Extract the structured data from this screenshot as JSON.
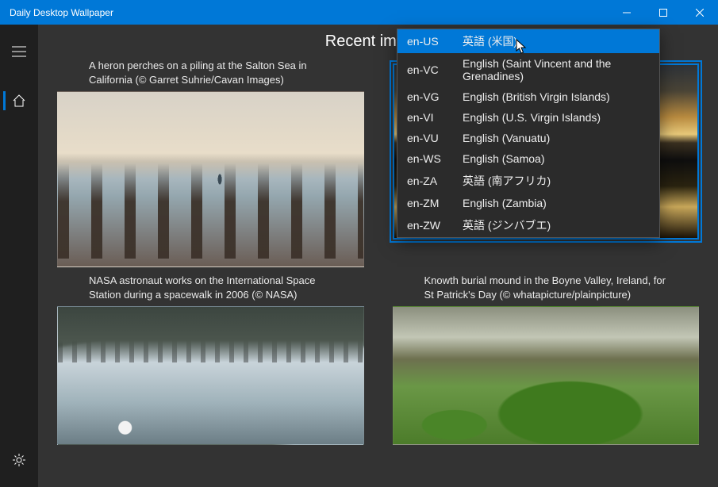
{
  "window": {
    "title": "Daily Desktop Wallpaper"
  },
  "heading": "Recent images",
  "cards": [
    {
      "caption": "A heron perches on a piling at the Salton Sea in California (© Garret Suhrie/Cavan Images)"
    },
    {
      "caption": ""
    },
    {
      "caption": "NASA astronaut works on the International Space Station during a spacewalk in 2006 (© NASA)"
    },
    {
      "caption": "Knowth burial mound in the Boyne Valley, Ireland, for St Patrick's Day (© whatapicture/plainpicture)"
    }
  ],
  "dropdown": {
    "items": [
      {
        "code": "en-US",
        "label": "英語 (米国)"
      },
      {
        "code": "en-VC",
        "label": "English (Saint Vincent and the Grenadines)"
      },
      {
        "code": "en-VG",
        "label": "English (British Virgin Islands)"
      },
      {
        "code": "en-VI",
        "label": "English (U.S. Virgin Islands)"
      },
      {
        "code": "en-VU",
        "label": "English (Vanuatu)"
      },
      {
        "code": "en-WS",
        "label": "English (Samoa)"
      },
      {
        "code": "en-ZA",
        "label": "英語 (南アフリカ)"
      },
      {
        "code": "en-ZM",
        "label": "English (Zambia)"
      },
      {
        "code": "en-ZW",
        "label": "英語 (ジンバブエ)"
      }
    ],
    "selected_index": 0
  }
}
